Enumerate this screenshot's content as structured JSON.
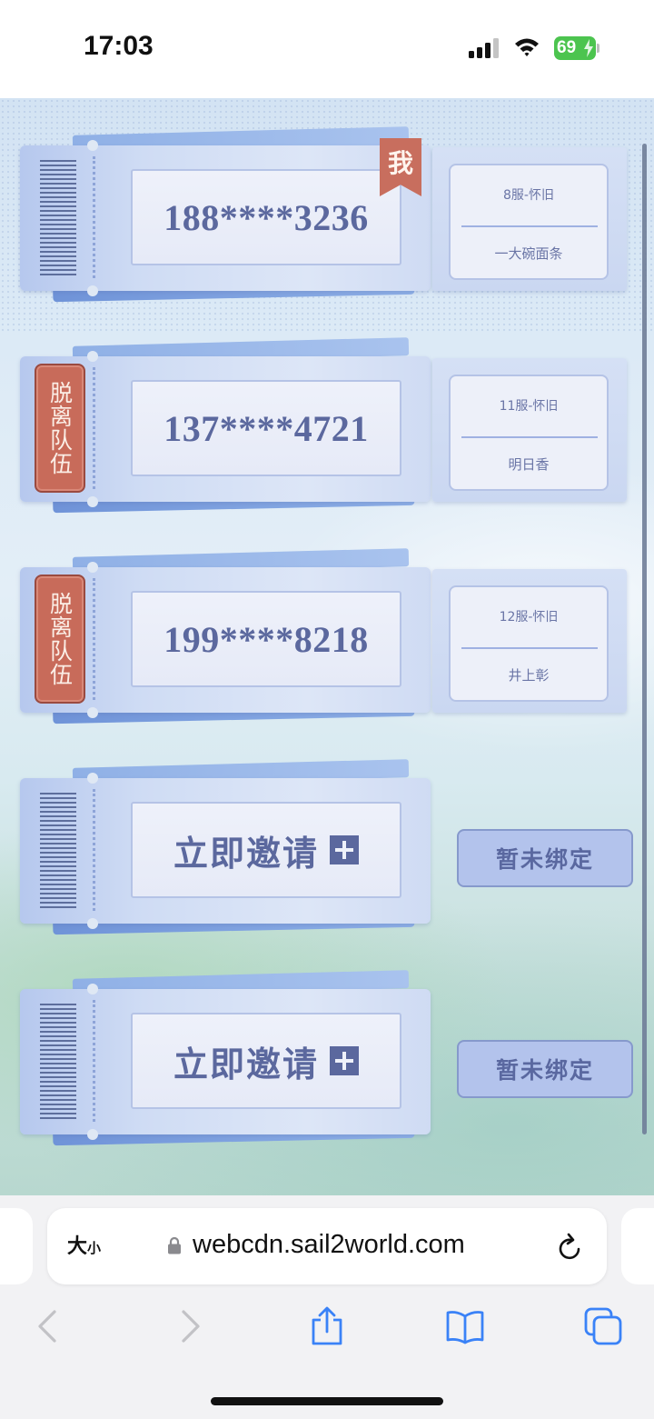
{
  "status_bar": {
    "time": "17:03",
    "battery": "69",
    "icons": [
      "signal-icon",
      "wifi-icon",
      "battery-icon"
    ]
  },
  "team": {
    "members": [
      {
        "phone": "188****3236",
        "server": "8服-怀旧",
        "name": "一大碗面条",
        "badge": "我",
        "badge_type": "me"
      },
      {
        "phone": "137****4721",
        "server": "11服-怀旧",
        "name": "明日香",
        "badge": "脱离队伍",
        "badge_type": "leave"
      },
      {
        "phone": "199****8218",
        "server": "12服-怀旧",
        "name": "井上彰",
        "badge": "脱离队伍",
        "badge_type": "leave"
      }
    ],
    "empty_slots": [
      {
        "invite_label": "立即邀请",
        "status": "暂未绑定"
      },
      {
        "invite_label": "立即邀请",
        "status": "暂未绑定"
      }
    ]
  },
  "browser": {
    "text_size_label_big": "大",
    "text_size_label_small": "小",
    "url": "webcdn.sail2world.com",
    "toolbar_icons": [
      "back-icon",
      "forward-icon",
      "share-icon",
      "bookmarks-icon",
      "tabs-icon"
    ]
  },
  "colors": {
    "accent": "#5b689e",
    "leave_red": "#c86b5a",
    "ticket_blue": "#cfdcf4",
    "toolbar_blue": "#3a82f7"
  }
}
